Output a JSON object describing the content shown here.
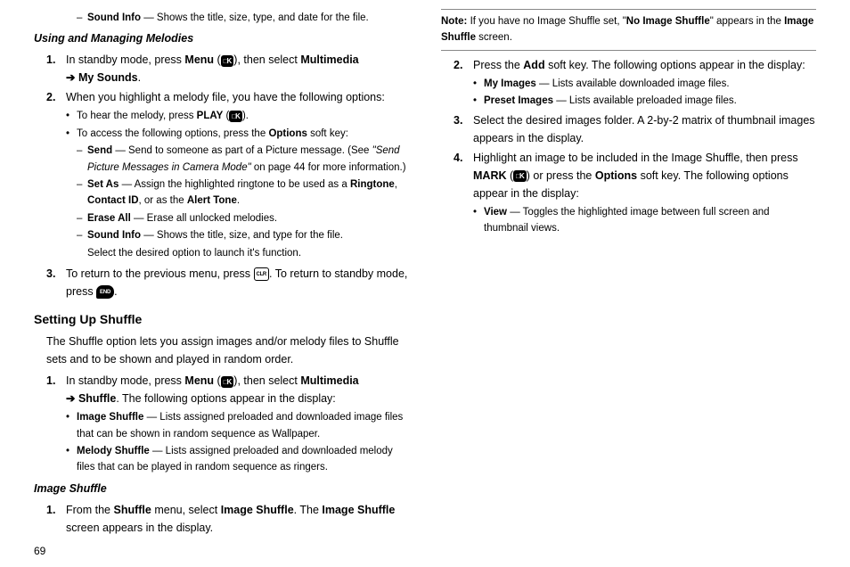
{
  "page_number": "69",
  "top_dash": {
    "label": "Sound Info",
    "desc": " — Shows the title, size, type, and date for the file."
  },
  "umm": {
    "heading": "Using and Managing Melodies",
    "step1_a": "In standby mode, press ",
    "step1_menu": "Menu",
    "step1_b": " (",
    "step1_c": "), then select ",
    "step1_mm": "Multimedia",
    "step1_d": "My Sounds",
    "step1_e": ".",
    "step2": "When you highlight a melody file, you have the following options:",
    "b1_a": "To hear the melody, press ",
    "b1_play": "PLAY",
    "b1_b": " (",
    "b1_c": ").",
    "b2_a": "To access the following options, press the ",
    "b2_opt": "Options",
    "b2_b": " soft key:",
    "d1_label": "Send",
    "d1_a": " — Send to someone as part of a Picture message. (See ",
    "d1_ref": "\"Send Picture Messages in Camera Mode\"",
    "d1_b": " on page 44 for more information.)",
    "d2_label": "Set As",
    "d2_a": " — Assign the highlighted ringtone to be used as a ",
    "d2_r": "Ringtone",
    "d2_b": ", ",
    "d2_c": "Contact ID",
    "d2_d": ", or as the ",
    "d2_e": "Alert Tone",
    "d2_f": ".",
    "d3_label": "Erase All",
    "d3_a": " — Erase all unlocked melodies.",
    "d4_label": "Sound Info",
    "d4_a": " — Shows the title, size, and type for the file.",
    "select_line": "Select the desired option to launch it's function.",
    "step3_a": "To return to the previous menu, press ",
    "step3_b": ". To return to standby mode, press ",
    "step3_c": "."
  },
  "sus": {
    "heading": "Setting Up Shuffle",
    "intro": "The Shuffle option lets you assign images and/or melody files to Shuffle sets and to be shown and played in random order.",
    "s1_a": "In standby mode, press ",
    "s1_menu": "Menu",
    "s1_b": " (",
    "s1_c": "), then select ",
    "s1_mm": "Multimedia",
    "s1_shuf": "Shuffle",
    "s1_d": ". The following options appear in the display:",
    "b_img_label": "Image Shuffle",
    "b_img_desc": " — Lists assigned preloaded and downloaded image files that can be shown in random sequence as Wallpaper.",
    "b_mel_label": "Melody Shuffle",
    "b_mel_desc": " — Lists assigned preloaded and downloaded melody files that can be played in random sequence as ringers."
  },
  "is": {
    "heading": "Image Shuffle",
    "s1_a": "From the ",
    "s1_shuf": "Shuffle",
    "s1_b": " menu, select ",
    "s1_is": "Image Shuffle",
    "s1_c": ". The ",
    "s1_is2": "Image Shuffle",
    "s1_d": " screen appears in the display.",
    "note_a": "Note:",
    "note_b": " If you have no Image Shuffle set, \"",
    "note_c": "No Image Shuffle",
    "note_d": "\" appears in the ",
    "note_e": "Image Shuffle",
    "note_f": " screen.",
    "s2_a": "Press the ",
    "s2_add": "Add",
    "s2_b": " soft key. The following options appear in the display:",
    "b_my_label": "My Images",
    "b_my_desc": " — Lists available downloaded image files.",
    "b_pre_label": "Preset Images",
    "b_pre_desc": " — Lists available preloaded image files.",
    "s3": "Select the desired images folder. A 2-by-2 matrix of thumbnail images appears in the display.",
    "s4_a": "Highlight an image to be included in the Image Shuffle, then press ",
    "s4_mark": "MARK",
    "s4_b": " (",
    "s4_c": ") or press the ",
    "s4_opt": "Options",
    "s4_d": " soft key. The following options appear in the display:",
    "b_view_label": "View",
    "b_view_desc": " — Toggles the highlighted image between full screen and thumbnail views."
  }
}
